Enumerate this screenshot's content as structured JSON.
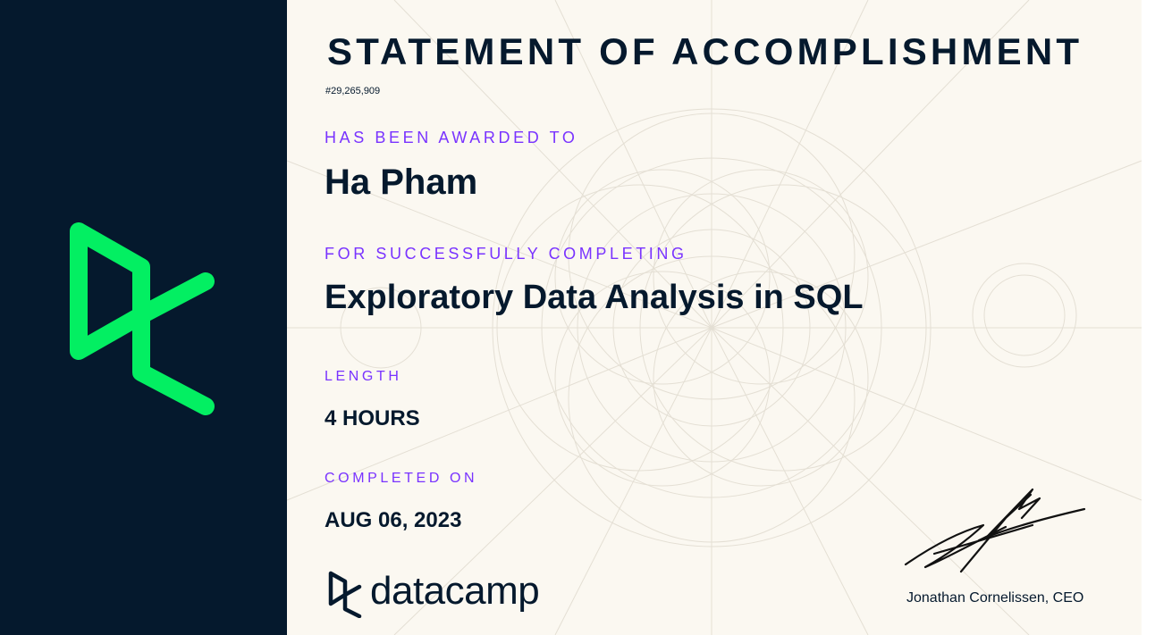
{
  "certificate": {
    "title": "STATEMENT OF ACCOMPLISHMENT",
    "id": "#29,265,909",
    "awarded_label": "HAS BEEN AWARDED TO",
    "recipient": "Ha Pham",
    "completing_label": "FOR SUCCESSFULLY COMPLETING",
    "course": "Exploratory Data Analysis in SQL",
    "length_label": "LENGTH",
    "length": "4 HOURS",
    "completed_label": "COMPLETED ON",
    "completed_date": "AUG 06, 2023",
    "signer": "Jonathan Cornelissen, CEO",
    "brand": "datacamp"
  },
  "colors": {
    "navy": "#05192D",
    "green": "#03EF62",
    "purple": "#7933FF",
    "paper": "#FBF8F1"
  },
  "icons": {
    "large_logo": "datacamp-logo-icon",
    "small_logo": "datacamp-logo-icon",
    "signature": "signature"
  }
}
